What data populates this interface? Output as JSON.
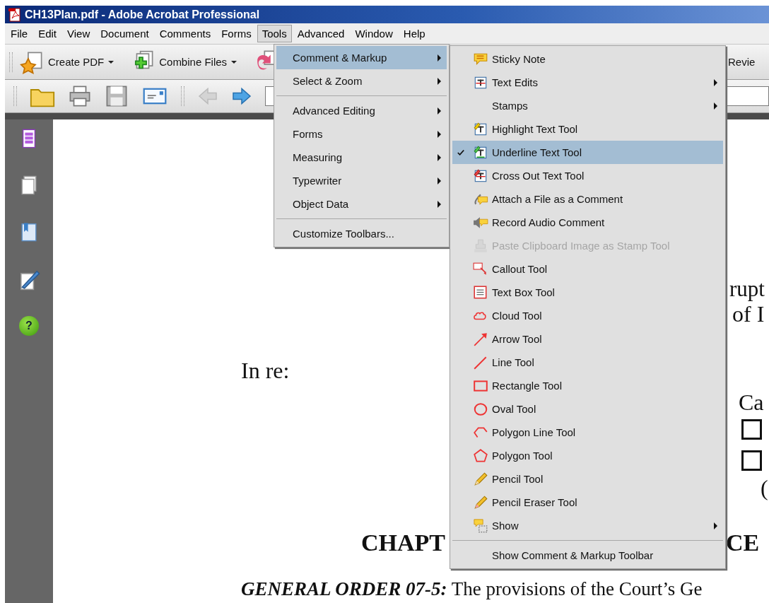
{
  "window": {
    "title": "CH13Plan.pdf - Adobe Acrobat Professional"
  },
  "menu_bar": [
    {
      "label": "File",
      "selected": false
    },
    {
      "label": "Edit",
      "selected": false
    },
    {
      "label": "View",
      "selected": false
    },
    {
      "label": "Document",
      "selected": false
    },
    {
      "label": "Comments",
      "selected": false
    },
    {
      "label": "Forms",
      "selected": false
    },
    {
      "label": "Tools",
      "selected": true
    },
    {
      "label": "Advanced",
      "selected": false
    },
    {
      "label": "Window",
      "selected": false
    },
    {
      "label": "Help",
      "selected": false
    }
  ],
  "toolbar": {
    "create_pdf": "Create PDF",
    "combine_files": "Combine Files",
    "review": "Revie"
  },
  "navigation_panel": {
    "help": "?"
  },
  "tools_menu": {
    "items": [
      {
        "label": "Comment & Markup",
        "kind": "submenu",
        "selected": true
      },
      {
        "label": "Select & Zoom",
        "kind": "submenu",
        "selected": false
      },
      {
        "kind": "separator"
      },
      {
        "label": "Advanced Editing",
        "kind": "submenu",
        "selected": false
      },
      {
        "label": "Forms",
        "kind": "submenu",
        "selected": false
      },
      {
        "label": "Measuring",
        "kind": "submenu",
        "selected": false
      },
      {
        "label": "Typewriter",
        "kind": "submenu",
        "selected": false
      },
      {
        "label": "Object Data",
        "kind": "submenu",
        "selected": false
      },
      {
        "kind": "separator"
      },
      {
        "label": "Customize Toolbars...",
        "kind": "command",
        "selected": false
      }
    ]
  },
  "comment_markup_menu": {
    "items": [
      {
        "label": "Sticky Note",
        "kind": "command",
        "selected": false,
        "checked": false,
        "disabled": false
      },
      {
        "label": "Text Edits",
        "kind": "submenu",
        "selected": false,
        "checked": false,
        "disabled": false
      },
      {
        "label": "Stamps",
        "kind": "submenu",
        "selected": false,
        "checked": false,
        "disabled": false
      },
      {
        "label": "Highlight Text Tool",
        "kind": "command",
        "selected": false,
        "checked": false,
        "disabled": false
      },
      {
        "label": "Underline Text Tool",
        "kind": "command",
        "selected": true,
        "checked": true,
        "disabled": false
      },
      {
        "label": "Cross Out Text Tool",
        "kind": "command",
        "selected": false,
        "checked": false,
        "disabled": false
      },
      {
        "label": "Attach a File as a Comment",
        "kind": "command",
        "selected": false,
        "checked": false,
        "disabled": false
      },
      {
        "label": "Record Audio Comment",
        "kind": "command",
        "selected": false,
        "checked": false,
        "disabled": false
      },
      {
        "label": "Paste Clipboard Image as Stamp Tool",
        "kind": "command",
        "selected": false,
        "checked": false,
        "disabled": true
      },
      {
        "label": "Callout Tool",
        "kind": "command",
        "selected": false,
        "checked": false,
        "disabled": false
      },
      {
        "label": "Text Box Tool",
        "kind": "command",
        "selected": false,
        "checked": false,
        "disabled": false
      },
      {
        "label": "Cloud Tool",
        "kind": "command",
        "selected": false,
        "checked": false,
        "disabled": false
      },
      {
        "label": "Arrow Tool",
        "kind": "command",
        "selected": false,
        "checked": false,
        "disabled": false
      },
      {
        "label": "Line Tool",
        "kind": "command",
        "selected": false,
        "checked": false,
        "disabled": false
      },
      {
        "label": "Rectangle Tool",
        "kind": "command",
        "selected": false,
        "checked": false,
        "disabled": false
      },
      {
        "label": "Oval Tool",
        "kind": "command",
        "selected": false,
        "checked": false,
        "disabled": false
      },
      {
        "label": "Polygon Line Tool",
        "kind": "command",
        "selected": false,
        "checked": false,
        "disabled": false
      },
      {
        "label": "Polygon Tool",
        "kind": "command",
        "selected": false,
        "checked": false,
        "disabled": false
      },
      {
        "label": "Pencil Tool",
        "kind": "command",
        "selected": false,
        "checked": false,
        "disabled": false
      },
      {
        "label": "Pencil Eraser Tool",
        "kind": "command",
        "selected": false,
        "checked": false,
        "disabled": false
      },
      {
        "label": "Show",
        "kind": "submenu",
        "selected": false,
        "checked": false,
        "disabled": false
      },
      {
        "kind": "separator"
      },
      {
        "label": "Show Comment & Markup Toolbar",
        "kind": "command",
        "selected": false,
        "checked": false,
        "disabled": false
      }
    ]
  },
  "document": {
    "fragments": [
      "rupt",
      "of I",
      "In re:",
      "Ca",
      "(",
      "CHAPT",
      "CE",
      "**GENERAL ORDER 07-5:** The provisions of the Court’s Ge"
    ],
    "checkboxes": [
      {
        "checked": false
      },
      {
        "checked": false
      }
    ]
  }
}
